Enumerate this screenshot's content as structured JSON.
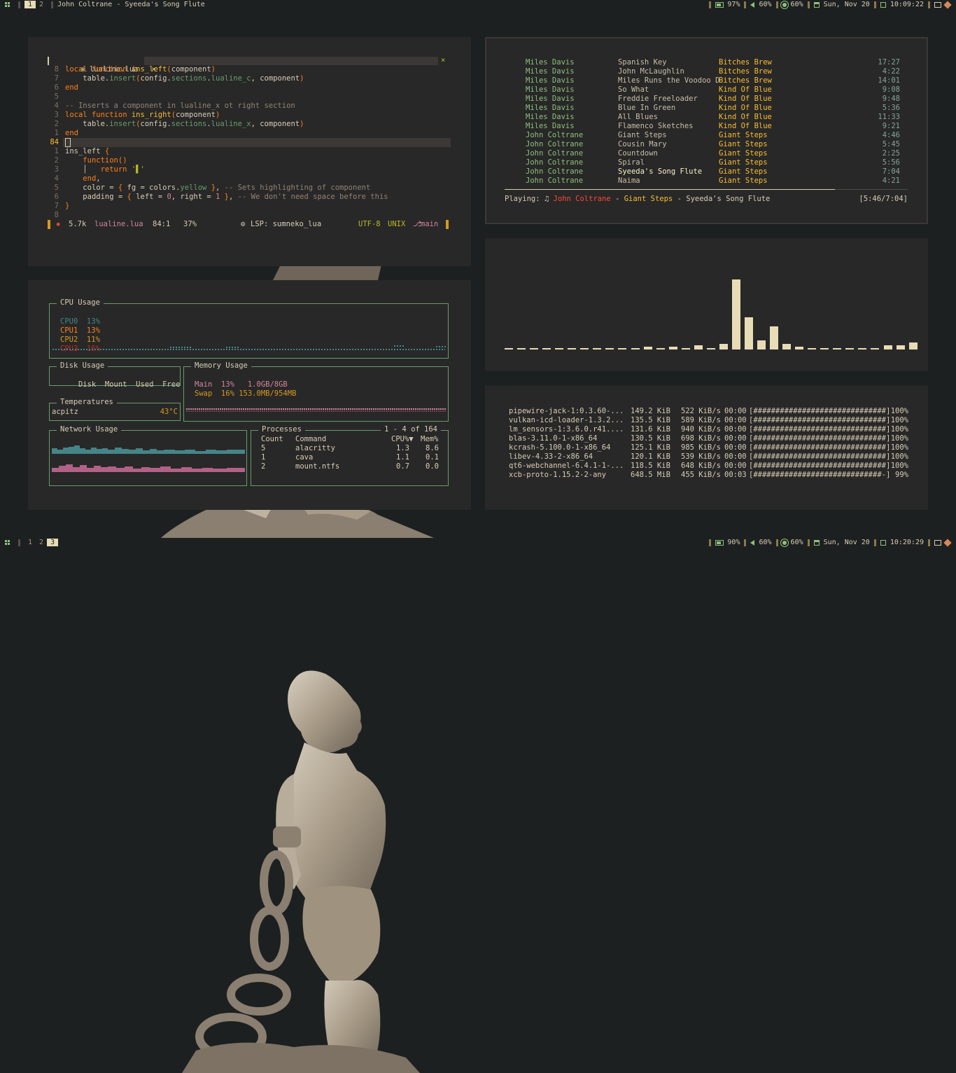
{
  "top_bar": {
    "workspaces": [
      "1",
      "2"
    ],
    "active_workspace": "1",
    "window_title": "John Coltrane - Syeeda's Song Flute",
    "battery": "97%",
    "volume": "60%",
    "brightness": "60%",
    "date": "Sun, Nov 20",
    "time": "10:09:22"
  },
  "bottom_bar": {
    "workspaces": [
      "1",
      "2",
      "3"
    ],
    "active_workspace": "3",
    "battery": "90%",
    "volume": "60%",
    "brightness": "60%",
    "date": "Sun, Nov 20",
    "time": "10:20:29"
  },
  "editor": {
    "tab_filename": "lualine.lua",
    "tab_close": "×",
    "window_close": "×",
    "lines": [
      {
        "num": "8",
        "text": "local function ins_left(component)"
      },
      {
        "num": "7",
        "text": "    table.insert(config.sections.lualine_c, component)"
      },
      {
        "num": "6",
        "text": "end"
      },
      {
        "num": "5",
        "text": ""
      },
      {
        "num": "4",
        "text": "-- Inserts a component in lualine_x ot right section"
      },
      {
        "num": "3",
        "text": "local function ins_right(component)"
      },
      {
        "num": "2",
        "text": "    table.insert(config.sections.lualine_x, component)"
      },
      {
        "num": "1",
        "text": "end"
      },
      {
        "num": "84",
        "text": ""
      },
      {
        "num": "1",
        "text": "ins_left {"
      },
      {
        "num": "2",
        "text": "    function()"
      },
      {
        "num": "3",
        "text": "    │   return '▌'"
      },
      {
        "num": "4",
        "text": "    end,"
      },
      {
        "num": "5",
        "text": "    color = { fg = colors.yellow }, -- Sets highlighting of component"
      },
      {
        "num": "6",
        "text": "    padding = { left = 0, right = 1 }, -- We don't need space before this"
      },
      {
        "num": "7",
        "text": "}"
      },
      {
        "num": "8",
        "text": ""
      }
    ],
    "status": {
      "size": "5.7k",
      "filename": "lualine.lua",
      "position": "84:1",
      "percent": "37%",
      "lsp": "LSP: sumneko_lua",
      "encoding": "UTF-8",
      "format": "UNIX",
      "branch": "main"
    }
  },
  "playlist": {
    "tracks": [
      {
        "artist": "Miles Davis",
        "title": "Spanish Key",
        "album": "Bitches Brew",
        "length": "17:27"
      },
      {
        "artist": "Miles Davis",
        "title": "John McLaughlin",
        "album": "Bitches Brew",
        "length": "4:22"
      },
      {
        "artist": "Miles Davis",
        "title": "Miles Runs the Voodoo D",
        "album": "Bitches Brew",
        "length": "14:01"
      },
      {
        "artist": "Miles Davis",
        "title": "So What",
        "album": "Kind Of Blue",
        "length": "9:08"
      },
      {
        "artist": "Miles Davis",
        "title": "Freddie Freeloader",
        "album": "Kind Of Blue",
        "length": "9:48"
      },
      {
        "artist": "Miles Davis",
        "title": "Blue In Green",
        "album": "Kind Of Blue",
        "length": "5:36"
      },
      {
        "artist": "Miles Davis",
        "title": "All Blues",
        "album": "Kind Of Blue",
        "length": "11:33"
      },
      {
        "artist": "Miles Davis",
        "title": "Flamenco Sketches",
        "album": "Kind Of Blue",
        "length": "9:21"
      },
      {
        "artist": "John Coltrane",
        "title": "Giant Steps",
        "album": "Giant Steps",
        "length": "4:46"
      },
      {
        "artist": "John Coltrane",
        "title": "Cousin Mary",
        "album": "Giant Steps",
        "length": "5:45"
      },
      {
        "artist": "John Coltrane",
        "title": "Countdown",
        "album": "Giant Steps",
        "length": "2:25"
      },
      {
        "artist": "John Coltrane",
        "title": "Spiral",
        "album": "Giant Steps",
        "length": "5:56"
      },
      {
        "artist": "John Coltrane",
        "title": "Syeeda's Song Flute",
        "album": "Giant Steps",
        "length": "7:04"
      },
      {
        "artist": "John Coltrane",
        "title": "Naima",
        "album": "Giant Steps",
        "length": "4:21"
      }
    ],
    "current_index": 12,
    "progress": 0.82,
    "now_playing_label": "Playing: ♫",
    "now_artist": "John Coltrane",
    "now_album": "Giant Steps",
    "now_title": "Syeeda's Song Flute",
    "dash": "-",
    "elapsed": "[5:46/7:04]"
  },
  "visualizer": {
    "levels": [
      0.01,
      0.01,
      0.01,
      0.01,
      0.01,
      0.01,
      0.01,
      0.01,
      0.01,
      0.01,
      0.02,
      0.04,
      0.02,
      0.04,
      0.02,
      0.06,
      0.01,
      0.08,
      1.0,
      0.46,
      0.13,
      0.33,
      0.08,
      0.04,
      0.01,
      0.01,
      0.01,
      0.01,
      0.01,
      0.01,
      0.06,
      0.06,
      0.1
    ]
  },
  "downloads": {
    "rows": [
      {
        "name": "pipewire-jack-1:0.3.60-...",
        "size": "149.2 KiB",
        "rate": "522 KiB/s",
        "eta": "00:00",
        "bar": "[##############################]",
        "pct": "100%"
      },
      {
        "name": "vulkan-icd-loader-1.3.2...",
        "size": "135.5 KiB",
        "rate": "589 KiB/s",
        "eta": "00:00",
        "bar": "[##############################]",
        "pct": "100%"
      },
      {
        "name": "lm_sensors-1:3.6.0.r41....",
        "size": "131.6 KiB",
        "rate": "940 KiB/s",
        "eta": "00:00",
        "bar": "[##############################]",
        "pct": "100%"
      },
      {
        "name": "blas-3.11.0-1-x86_64",
        "size": "130.5 KiB",
        "rate": "698 KiB/s",
        "eta": "00:00",
        "bar": "[##############################]",
        "pct": "100%"
      },
      {
        "name": "kcrash-5.100.0-1-x86_64",
        "size": "125.1 KiB",
        "rate": "985 KiB/s",
        "eta": "00:00",
        "bar": "[##############################]",
        "pct": "100%"
      },
      {
        "name": "libev-4.33-2-x86_64",
        "size": "120.1 KiB",
        "rate": "539 KiB/s",
        "eta": "00:00",
        "bar": "[##############################]",
        "pct": "100%"
      },
      {
        "name": "qt6-webchannel-6.4.1-1-...",
        "size": "118.5 KiB",
        "rate": "648 KiB/s",
        "eta": "00:00",
        "bar": "[##############################]",
        "pct": "100%"
      },
      {
        "name": "xcb-proto-1.15.2-2-any",
        "size": "648.5 MiB",
        "rate": "455 KiB/s",
        "eta": "00:03",
        "bar": "[#############################-]",
        "pct": "99%"
      }
    ]
  },
  "sysmon": {
    "cpu_title": "CPU Usage",
    "cpus": [
      {
        "label": "CPU0",
        "value": "13%",
        "color": "#458588"
      },
      {
        "label": "CPU1",
        "value": "13%",
        "color": "#fe8019"
      },
      {
        "label": "CPU2",
        "value": "11%",
        "color": "#d79921"
      },
      {
        "label": "CPU3",
        "value": "16%",
        "color": "#cc241d"
      }
    ],
    "disk_title": "Disk Usage",
    "disk_headers": [
      "Disk",
      "Mount",
      "Used",
      "Free"
    ],
    "temp_title": "Temperatures",
    "temp_sensor": "acpitz",
    "temp_value": "43°C",
    "mem_title": "Memory Usage",
    "mem_main": "Main  13%   1.0GB/8GB",
    "mem_swap": "Swap  16% 153.0MB/954MB",
    "net_title": "Network Usage",
    "proc_title": "Processes",
    "proc_count": "1 - 4 of 164",
    "proc_headers": [
      "Count",
      "Command",
      "CPU%▼",
      "Mem%"
    ],
    "procs": [
      {
        "count": "5",
        "command": "alacritty",
        "cpu": "1.3",
        "mem": "8.6"
      },
      {
        "count": "1",
        "command": "cava",
        "cpu": "1.1",
        "mem": "0.1"
      },
      {
        "count": "2",
        "command": "mount.ntfs",
        "cpu": "0.7",
        "mem": "0.0"
      }
    ]
  }
}
